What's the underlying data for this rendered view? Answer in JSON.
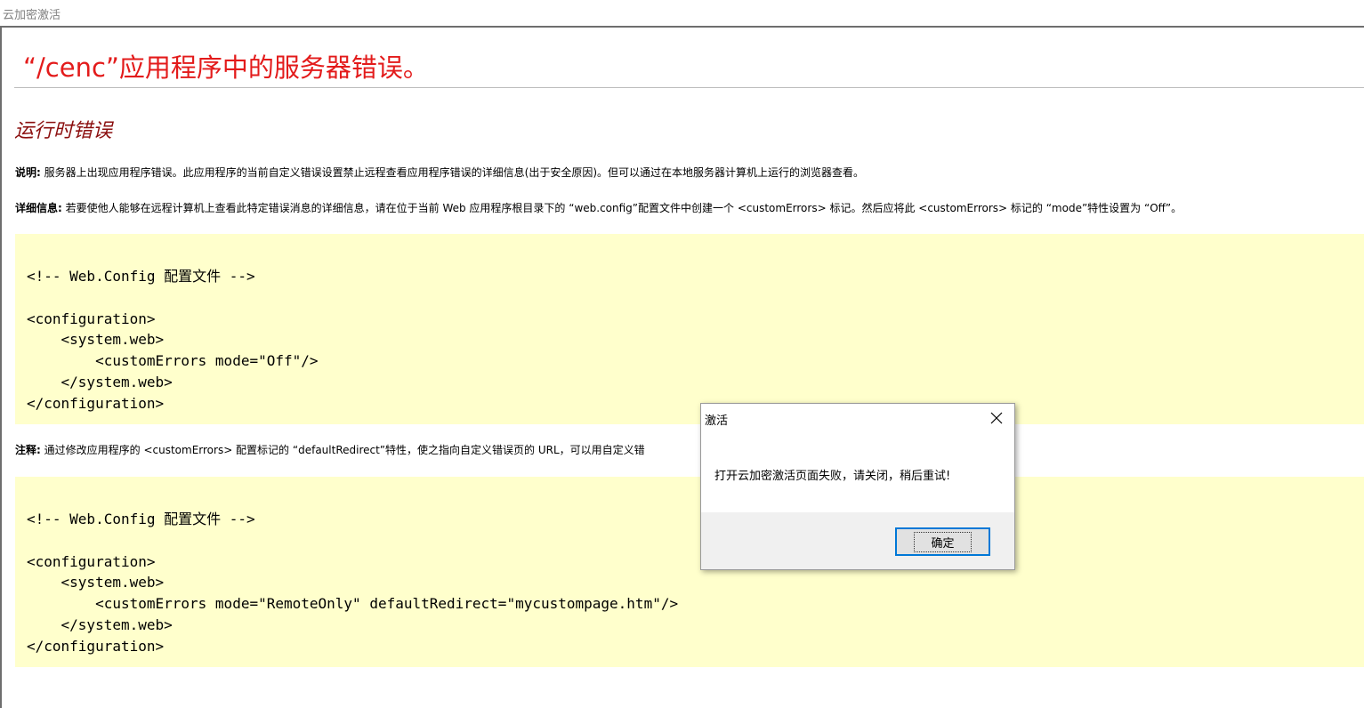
{
  "window": {
    "title": "云加密激活"
  },
  "page": {
    "title": "“/cenc”应用程序中的服务器错误。",
    "subtitle": "运行时错误",
    "description": {
      "label": "说明:",
      "text": " 服务器上出现应用程序错误。此应用程序的当前自定义错误设置禁止远程查看应用程序错误的详细信息(出于安全原因)。但可以通过在本地服务器计算机上运行的浏览器查看。"
    },
    "details": {
      "label": "详细信息:",
      "text": " 若要使他人能够在远程计算机上查看此特定错误消息的详细信息，请在位于当前 Web 应用程序根目录下的 “web.config”配置文件中创建一个 <customErrors> 标记。然后应将此 <customErrors> 标记的 “mode”特性设置为 “Off”。"
    },
    "code_block_1": "<!-- Web.Config 配置文件 -->\n\n<configuration>\n    <system.web>\n        <customErrors mode=\"Off\"/>\n    </system.web>\n</configuration>",
    "note": {
      "label": "注释:",
      "text": " 通过修改应用程序的 <customErrors> 配置标记的 “defaultRedirect”特性，使之指向自定义错误页的 URL，可以用自定义错"
    },
    "code_block_2": "<!-- Web.Config 配置文件 -->\n\n<configuration>\n    <system.web>\n        <customErrors mode=\"RemoteOnly\" defaultRedirect=\"mycustompage.htm\"/>\n    </system.web>\n</configuration>"
  },
  "dialog": {
    "title": "激活",
    "message": "打开云加密激活页面失败，请关闭，稍后重试!",
    "ok_label": "确定",
    "close_icon": "close-icon"
  },
  "colors": {
    "title_red": "#e31b1b",
    "subtitle_maroon": "#8b0f0f",
    "code_bg": "#ffffcc",
    "button_focus": "#0078d7"
  }
}
